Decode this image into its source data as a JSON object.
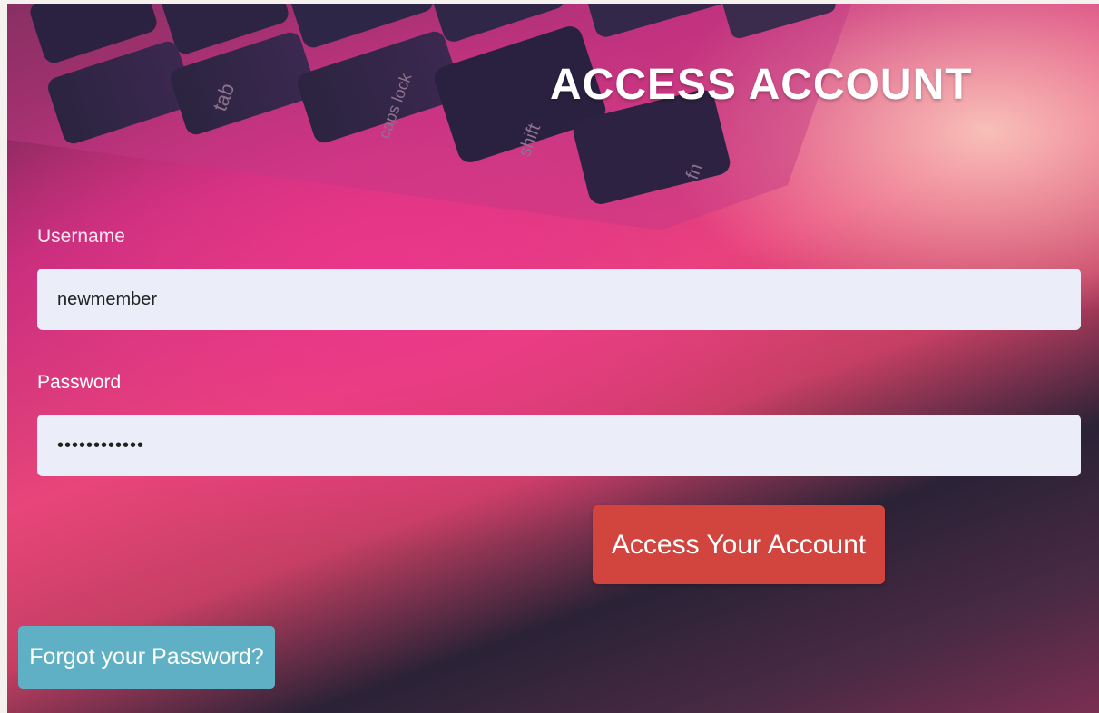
{
  "page_title": "ACCESS  ACCOUNT",
  "form": {
    "username_label": "Username",
    "username_value": "newmember",
    "password_label": "Password",
    "password_value": "••••••••••••",
    "submit_label": "Access Your Account",
    "forgot_label": "Forgot your Password?"
  },
  "background_keys": [
    "tab",
    "caps lock",
    "shift",
    "fn"
  ],
  "colors": {
    "submit_button": "#d2443e",
    "forgot_button": "#5fb0c4",
    "input_background": "#ebeef8"
  }
}
